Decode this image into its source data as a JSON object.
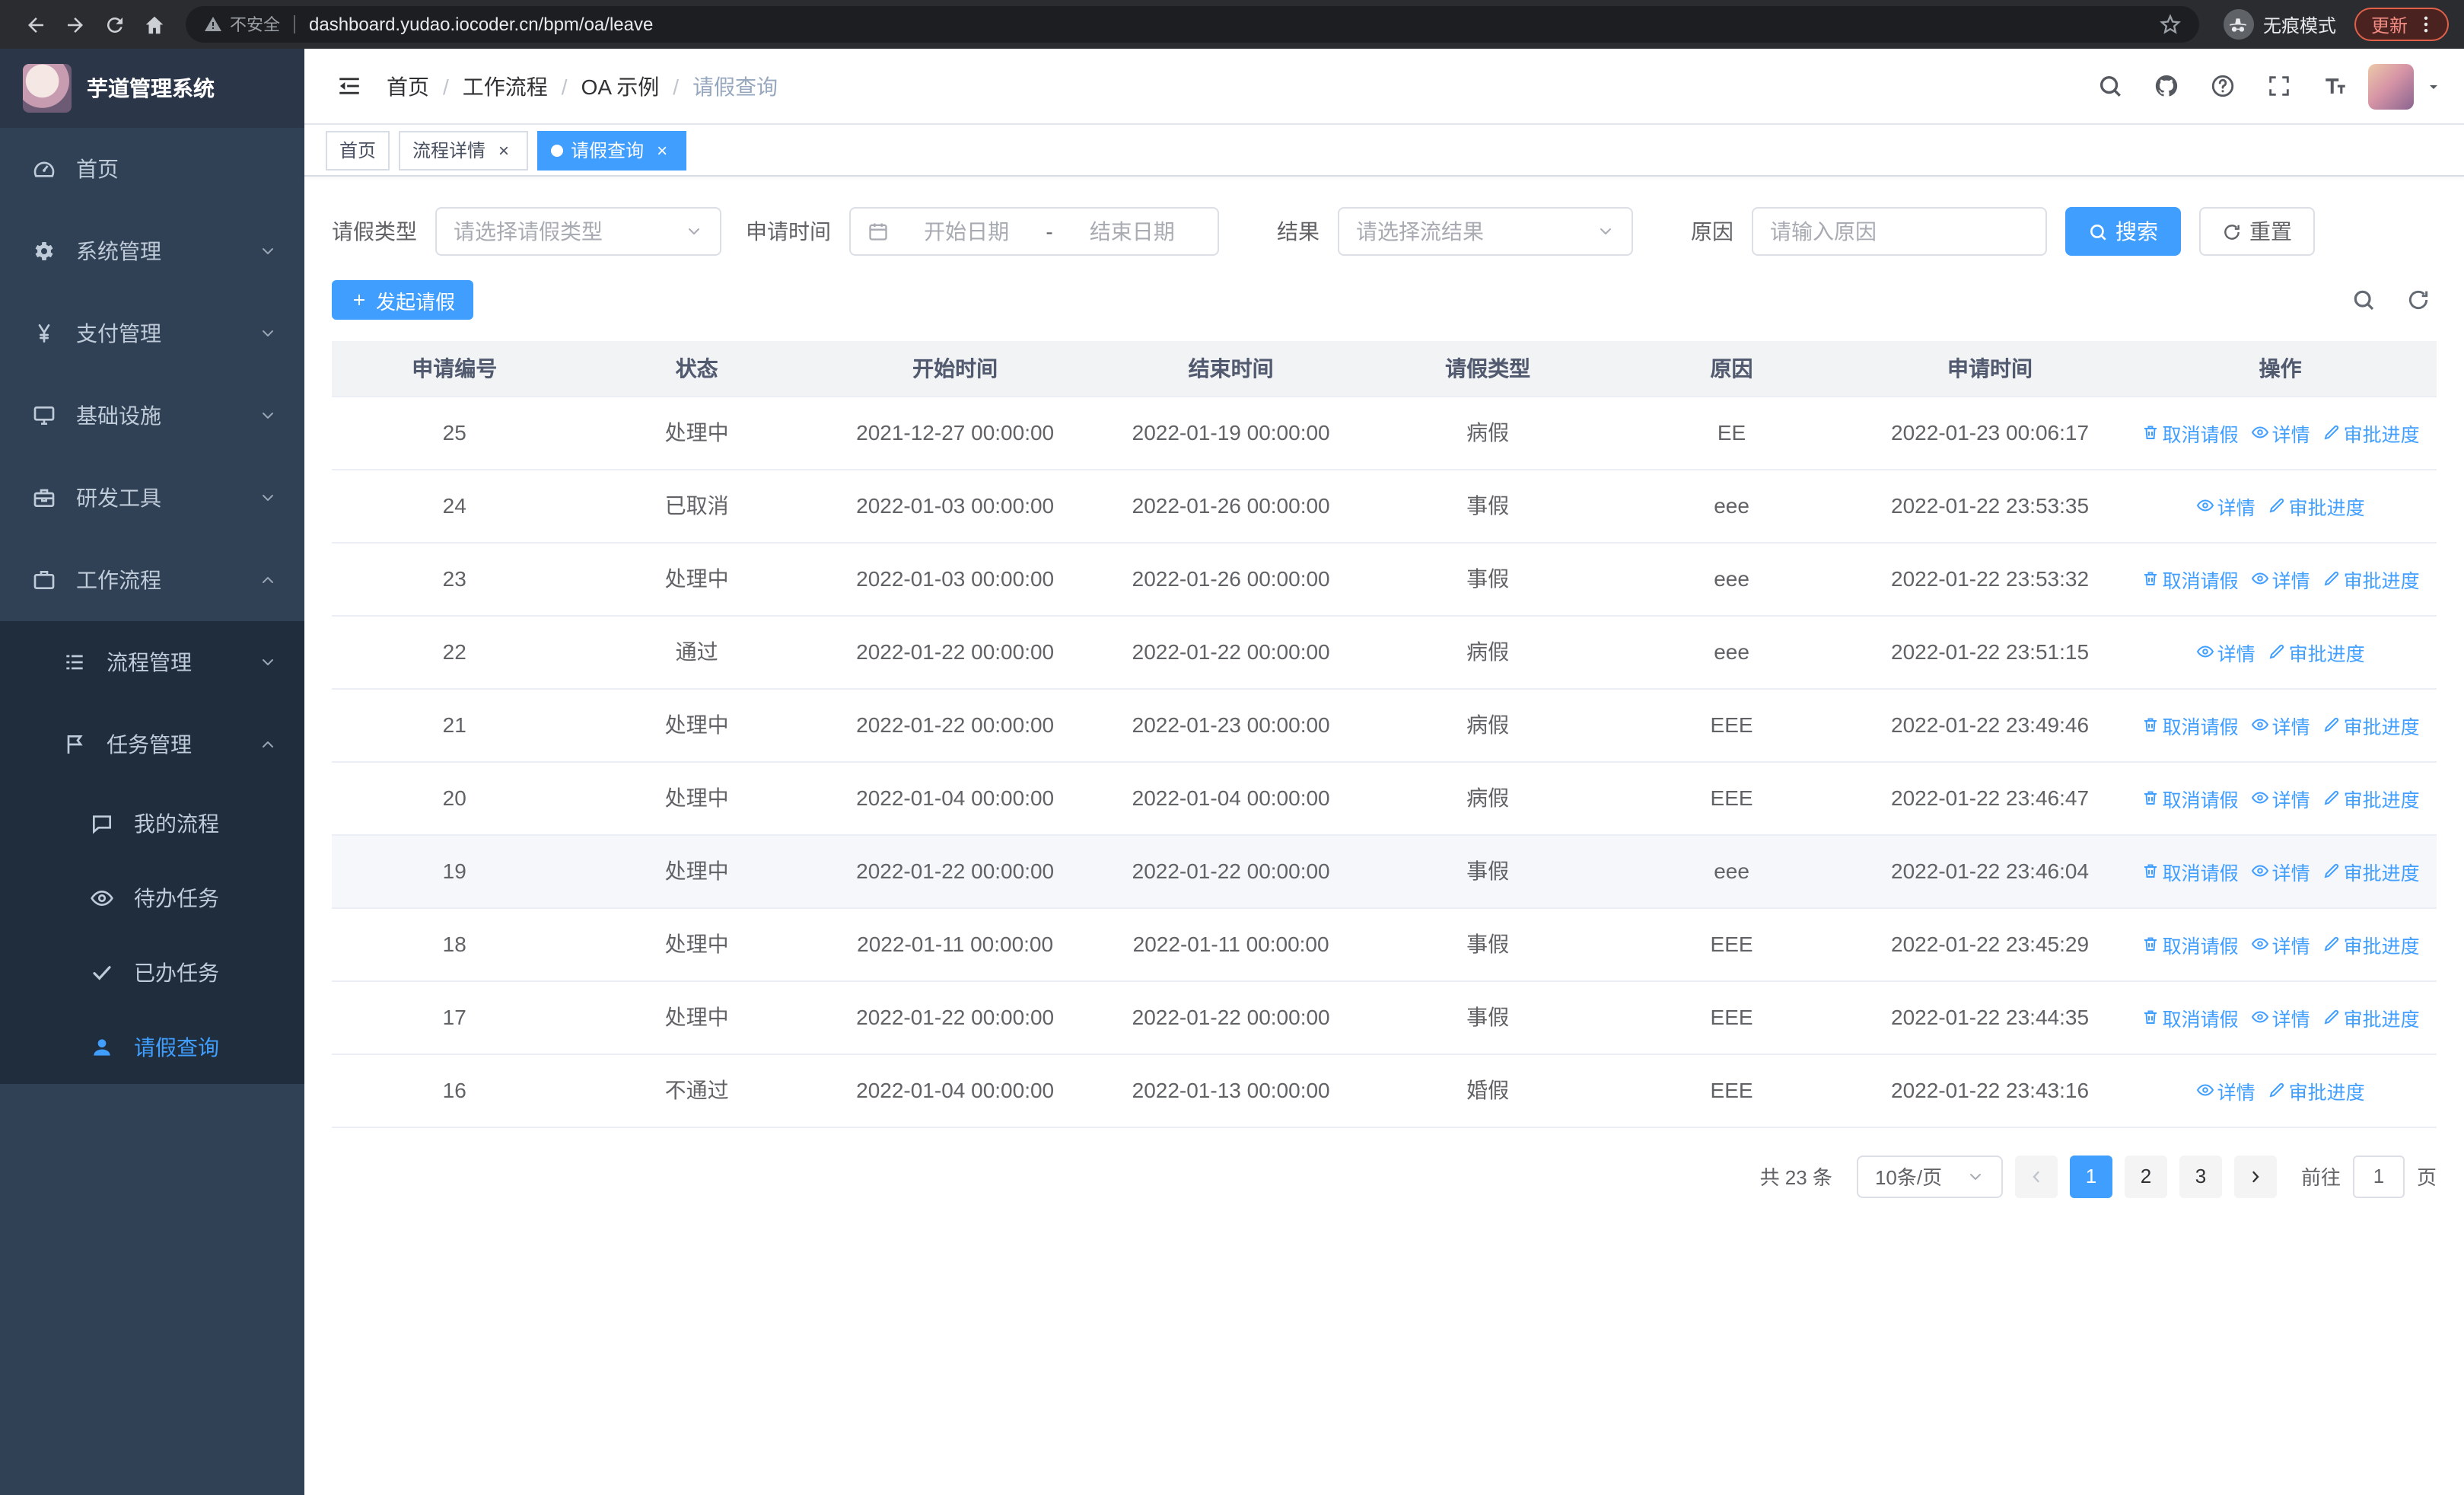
{
  "theme": {
    "accent": "#409EFF",
    "sidebar_bg": "#304156",
    "submenu_bg": "#1f2d3d"
  },
  "browser": {
    "security_label": "不安全",
    "url": "dashboard.yudao.iocoder.cn/bpm/oa/leave",
    "incognito_label": "无痕模式",
    "update_label": "更新"
  },
  "sidebar": {
    "app_title": "芋道管理系统",
    "items": [
      {
        "name": "home",
        "label": "首页",
        "icon": "dashboard-icon",
        "level": 1
      },
      {
        "name": "system",
        "label": "系统管理",
        "icon": "gear-icon",
        "level": 1,
        "chevron": "down"
      },
      {
        "name": "payment",
        "label": "支付管理",
        "icon": "yen-icon",
        "level": 1,
        "chevron": "down"
      },
      {
        "name": "infrastructure",
        "label": "基础设施",
        "icon": "monitor-icon",
        "level": 1,
        "chevron": "down"
      },
      {
        "name": "dev-tools",
        "label": "研发工具",
        "icon": "toolbox-icon",
        "level": 1,
        "chevron": "down"
      },
      {
        "name": "workflow",
        "label": "工作流程",
        "icon": "briefcase-icon",
        "level": 1,
        "chevron": "up"
      },
      {
        "name": "process-mgmt",
        "label": "流程管理",
        "icon": "list-icon",
        "level": 2,
        "chevron": "down",
        "submenu": true
      },
      {
        "name": "task-mgmt",
        "label": "任务管理",
        "icon": "flag-icon",
        "level": 2,
        "chevron": "up",
        "submenu": true
      },
      {
        "name": "my-process",
        "label": "我的流程",
        "icon": "chat-icon",
        "level": 3,
        "submenu": true
      },
      {
        "name": "todo-tasks",
        "label": "待办任务",
        "icon": "eye-icon",
        "level": 3,
        "submenu": true
      },
      {
        "name": "done-tasks",
        "label": "已办任务",
        "icon": "check-icon",
        "level": 3,
        "submenu": true
      },
      {
        "name": "leave-query",
        "label": "请假查询",
        "icon": "user-icon",
        "level": 3,
        "submenu": true,
        "active": true
      }
    ]
  },
  "header": {
    "breadcrumb": [
      "首页",
      "工作流程",
      "OA 示例",
      "请假查询"
    ],
    "separator": "/"
  },
  "tabs": [
    {
      "name": "home",
      "label": "首页",
      "active": false,
      "closable": false
    },
    {
      "name": "process-detail",
      "label": "流程详情",
      "active": false,
      "closable": true
    },
    {
      "name": "leave-query",
      "label": "请假查询",
      "active": true,
      "closable": true
    }
  ],
  "filters": {
    "leave_type_label": "请假类型",
    "leave_type_placeholder": "请选择请假类型",
    "apply_time_label": "申请时间",
    "start_date_placeholder": "开始日期",
    "range_separator": "-",
    "end_date_placeholder": "结束日期",
    "result_label": "结果",
    "result_placeholder": "请选择流结果",
    "reason_label": "原因",
    "reason_placeholder": "请输入原因",
    "search_button": "搜索",
    "reset_button": "重置"
  },
  "toolbar": {
    "create_button": "发起请假"
  },
  "table": {
    "columns": [
      "申请编号",
      "状态",
      "开始时间",
      "结束时间",
      "请假类型",
      "原因",
      "申请时间",
      "操作"
    ],
    "action_labels": {
      "cancel": "取消请假",
      "detail": "详情",
      "progress": "审批进度"
    },
    "rows": [
      {
        "id": "25",
        "status": "处理中",
        "start": "2021-12-27 00:00:00",
        "end": "2022-01-19 00:00:00",
        "type": "病假",
        "reason": "EE",
        "apply": "2022-01-23 00:06:17",
        "actions": [
          "cancel",
          "detail",
          "progress"
        ]
      },
      {
        "id": "24",
        "status": "已取消",
        "start": "2022-01-03 00:00:00",
        "end": "2022-01-26 00:00:00",
        "type": "事假",
        "reason": "eee",
        "apply": "2022-01-22 23:53:35",
        "actions": [
          "detail",
          "progress"
        ]
      },
      {
        "id": "23",
        "status": "处理中",
        "start": "2022-01-03 00:00:00",
        "end": "2022-01-26 00:00:00",
        "type": "事假",
        "reason": "eee",
        "apply": "2022-01-22 23:53:32",
        "actions": [
          "cancel",
          "detail",
          "progress"
        ]
      },
      {
        "id": "22",
        "status": "通过",
        "start": "2022-01-22 00:00:00",
        "end": "2022-01-22 00:00:00",
        "type": "病假",
        "reason": "eee",
        "apply": "2022-01-22 23:51:15",
        "actions": [
          "detail",
          "progress"
        ]
      },
      {
        "id": "21",
        "status": "处理中",
        "start": "2022-01-22 00:00:00",
        "end": "2022-01-23 00:00:00",
        "type": "病假",
        "reason": "EEE",
        "apply": "2022-01-22 23:49:46",
        "actions": [
          "cancel",
          "detail",
          "progress"
        ]
      },
      {
        "id": "20",
        "status": "处理中",
        "start": "2022-01-04 00:00:00",
        "end": "2022-01-04 00:00:00",
        "type": "病假",
        "reason": "EEE",
        "apply": "2022-01-22 23:46:47",
        "actions": [
          "cancel",
          "detail",
          "progress"
        ]
      },
      {
        "id": "19",
        "status": "处理中",
        "start": "2022-01-22 00:00:00",
        "end": "2022-01-22 00:00:00",
        "type": "事假",
        "reason": "eee",
        "apply": "2022-01-22 23:46:04",
        "actions": [
          "cancel",
          "detail",
          "progress"
        ],
        "highlighted": true
      },
      {
        "id": "18",
        "status": "处理中",
        "start": "2022-01-11 00:00:00",
        "end": "2022-01-11 00:00:00",
        "type": "事假",
        "reason": "EEE",
        "apply": "2022-01-22 23:45:29",
        "actions": [
          "cancel",
          "detail",
          "progress"
        ]
      },
      {
        "id": "17",
        "status": "处理中",
        "start": "2022-01-22 00:00:00",
        "end": "2022-01-22 00:00:00",
        "type": "事假",
        "reason": "EEE",
        "apply": "2022-01-22 23:44:35",
        "actions": [
          "cancel",
          "detail",
          "progress"
        ]
      },
      {
        "id": "16",
        "status": "不通过",
        "start": "2022-01-04 00:00:00",
        "end": "2022-01-13 00:00:00",
        "type": "婚假",
        "reason": "EEE",
        "apply": "2022-01-22 23:43:16",
        "actions": [
          "detail",
          "progress"
        ]
      }
    ]
  },
  "pagination": {
    "total_label": "共 23 条",
    "page_size": "10条/页",
    "pages": [
      "1",
      "2",
      "3"
    ],
    "active_page": "1",
    "goto_label": "前往",
    "goto_value": "1",
    "goto_suffix": "页"
  }
}
